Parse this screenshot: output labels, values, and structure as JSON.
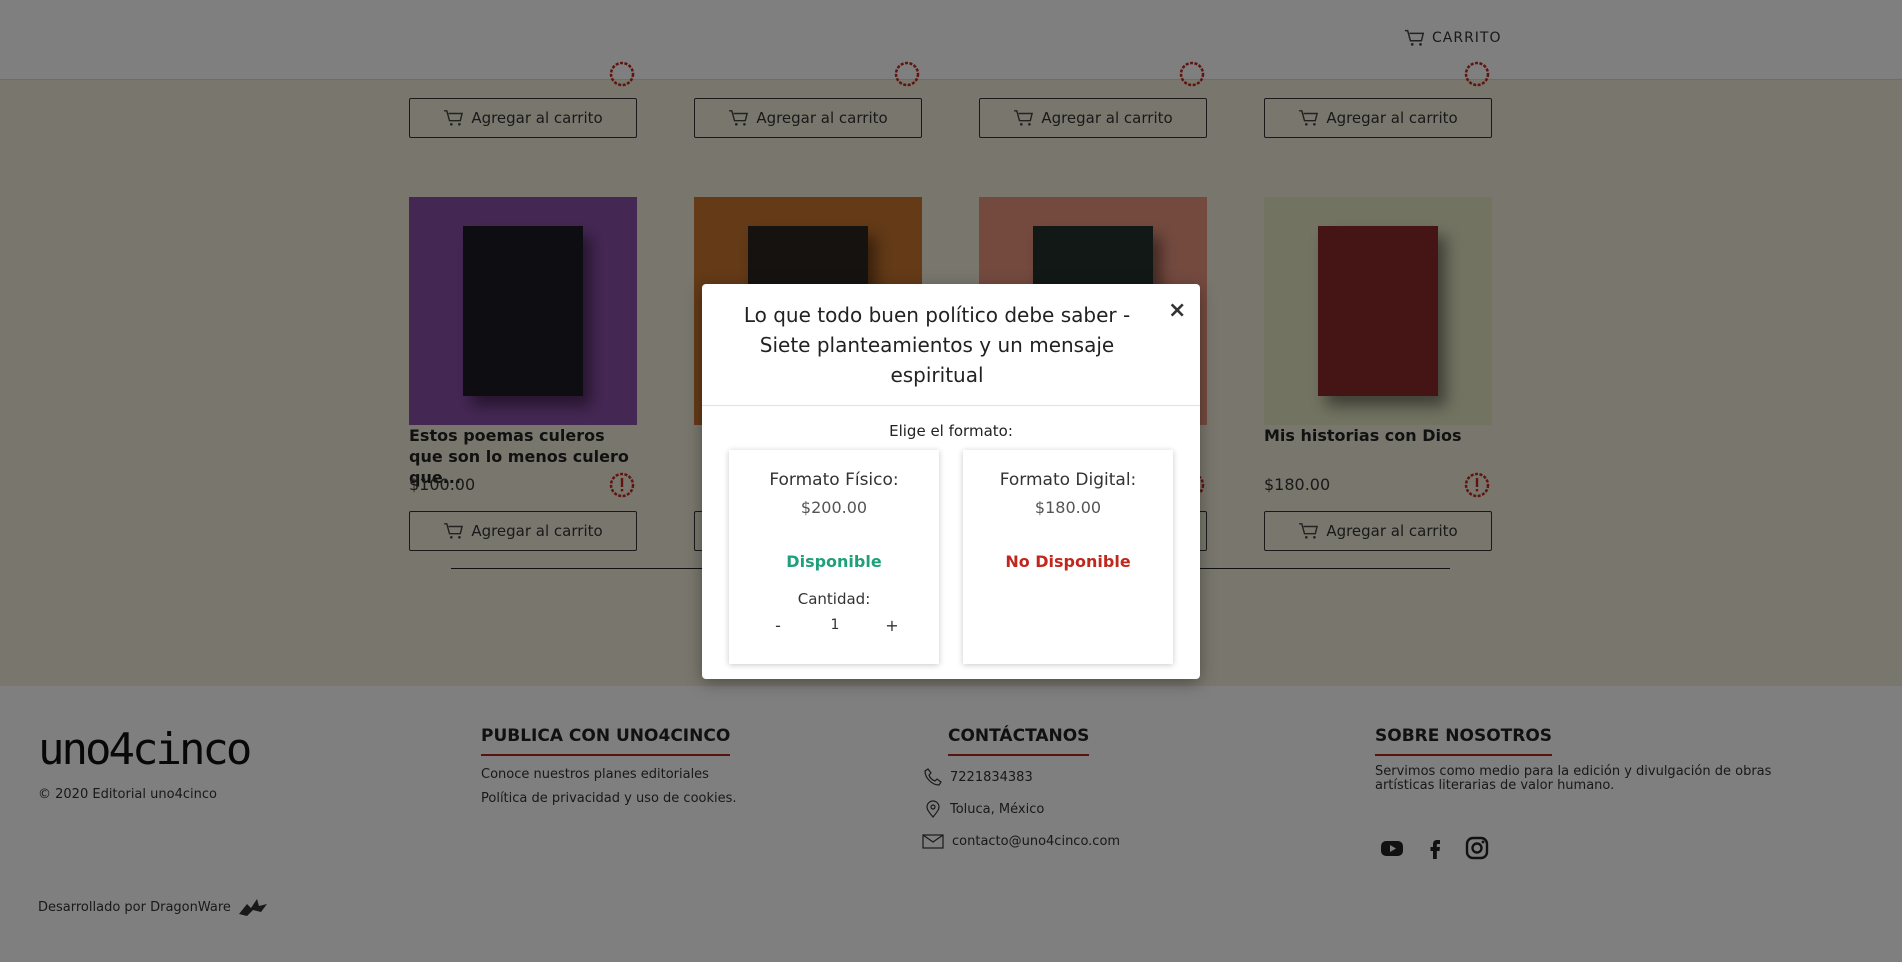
{
  "header": {
    "cart_label": "CARRITO"
  },
  "add_to_cart_label": "Agregar al carrito",
  "products_row2": [
    {
      "title": "Estos poemas culeros que son lo menos culero que...",
      "price": "$100.00",
      "bg": "#8a4fa8"
    },
    {
      "title": "Lo que todo buen político debe saber - Siete planteamientos y un mensaje espiritual",
      "price": "$200.00",
      "bg": "#c8752f"
    },
    {
      "title": "",
      "price": "",
      "bg": "#e9957e"
    },
    {
      "title": "Mis historias con Dios",
      "price": "$180.00",
      "bg": "#e6e6c4"
    }
  ],
  "footer": {
    "copyright": "© 2020 Editorial uno4cinco",
    "developed_by": "Desarrollado por DragonWare",
    "publish": {
      "heading": "PUBLICA CON UNO4CINCO",
      "links": [
        "Conoce nuestros planes editoriales",
        "Política de privacidad y uso de cookies."
      ]
    },
    "contact": {
      "heading": "CONTÁCTANOS",
      "phone": "7221834383",
      "location": "Toluca, México",
      "email": "contacto@uno4cinco.com"
    },
    "about": {
      "heading": "SOBRE NOSOTROS",
      "text": "Servimos como medio para la edición y divulgación de obras artísticas literarias de valor humano."
    }
  },
  "modal": {
    "title": "Lo que todo buen político debe saber - Siete planteamientos y un mensaje espiritual",
    "close": "×",
    "choose_label": "Elige el formato:",
    "formats": [
      {
        "name": "Formato Físico:",
        "price": "$200.00",
        "status": "Disponible",
        "status_color": "#1fa07a",
        "quantity_label": "Cantidad:",
        "quantity": "1",
        "minus": "-",
        "plus": "+"
      },
      {
        "name": "Formato Digital:",
        "price": "$180.00",
        "status": "No Disponible",
        "status_color": "#c0281e"
      }
    ]
  },
  "colors": {
    "accent": "#b3261e",
    "available": "#1fa07a",
    "unavailable": "#c0281e"
  }
}
